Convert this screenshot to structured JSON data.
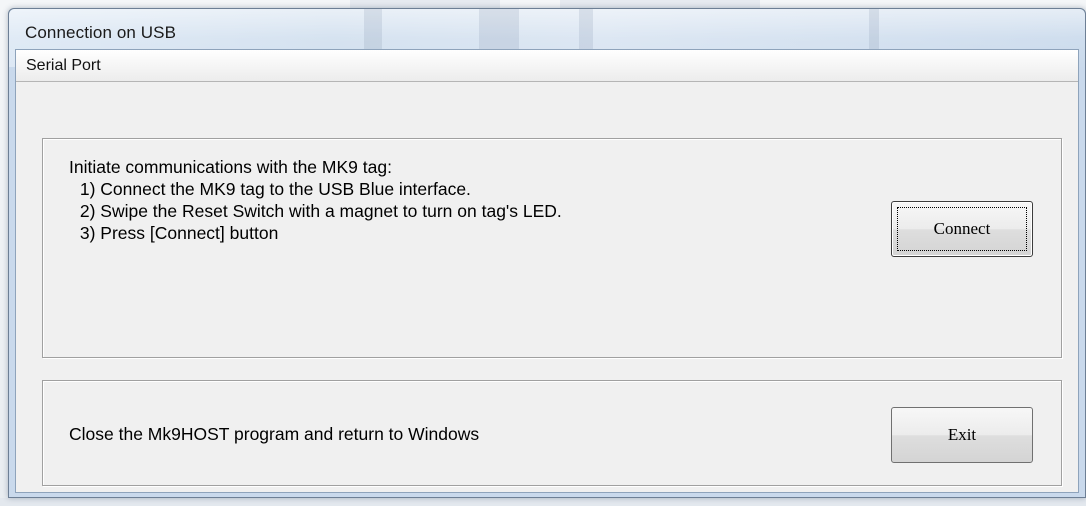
{
  "window": {
    "title": "Connection on USB"
  },
  "tab": {
    "label": "Serial Port"
  },
  "connect_group": {
    "heading": "Initiate communications with the MK9 tag:",
    "steps": [
      " 1) Connect the MK9 tag to the USB Blue interface.",
      " 2) Swipe the Reset Switch with a magnet to turn on tag's LED.",
      " 3) Press [Connect] button"
    ],
    "button_label": "Connect"
  },
  "exit_group": {
    "text": "Close the Mk9HOST program and return to Windows",
    "button_label": "Exit"
  },
  "colors": {
    "client_background": "#f0f0f0",
    "titlebar_accent": "#c9d9ec",
    "button_border": "#707070"
  }
}
